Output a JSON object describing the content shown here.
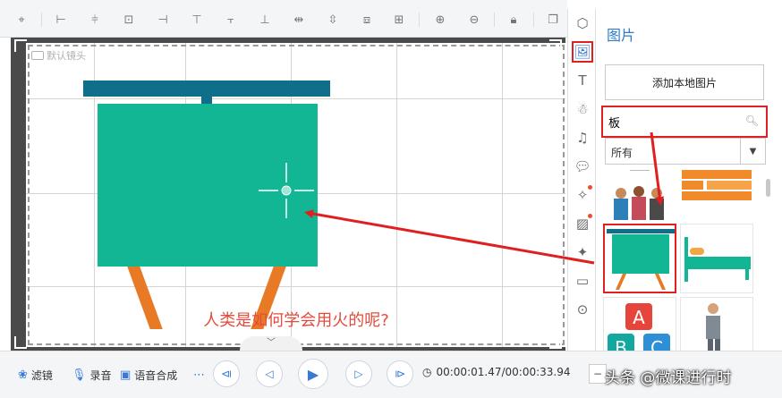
{
  "colors": {
    "accent": "#2f7bc7",
    "highlight": "#e02020",
    "board_green": "#12b594",
    "board_top": "#0f6f8a",
    "easel_legs": "#e87a26",
    "subtitle": "#e44b3c"
  },
  "toolbar": {
    "icons": [
      "lock-select-icon",
      "align-left-icon",
      "align-hcenter-icon",
      "align-box-icon",
      "align-right-icon",
      "align-top-icon",
      "align-vcenter-icon",
      "align-bottom-icon",
      "distribute-h-icon",
      "distribute-v-icon",
      "zoom-in-icon",
      "zoom-out-icon",
      "lock-icon",
      "copy-icon",
      "shapes-icon"
    ]
  },
  "canvas": {
    "camera_label": "默认镜头",
    "subtitle": "人类是如何学会用火的呢?"
  },
  "panel": {
    "title": "图片",
    "add_local_label": "添加本地图片",
    "search_value": "板",
    "filter_value": "所有"
  },
  "vtoolbar": {
    "icons": [
      "image-icon",
      "text-icon",
      "character-icon",
      "music-icon",
      "bubble-icon",
      "special-effect-icon",
      "photo-icon",
      "magic-wand-icon",
      "folder-icon",
      "more-icon"
    ]
  },
  "bottom": {
    "filter_label": "滤镜",
    "record_label": "录音",
    "tts_label": "语音合成",
    "timecode": "00:00:01.47/00:00:33.94",
    "watermark": "头条 @微课进行时"
  }
}
